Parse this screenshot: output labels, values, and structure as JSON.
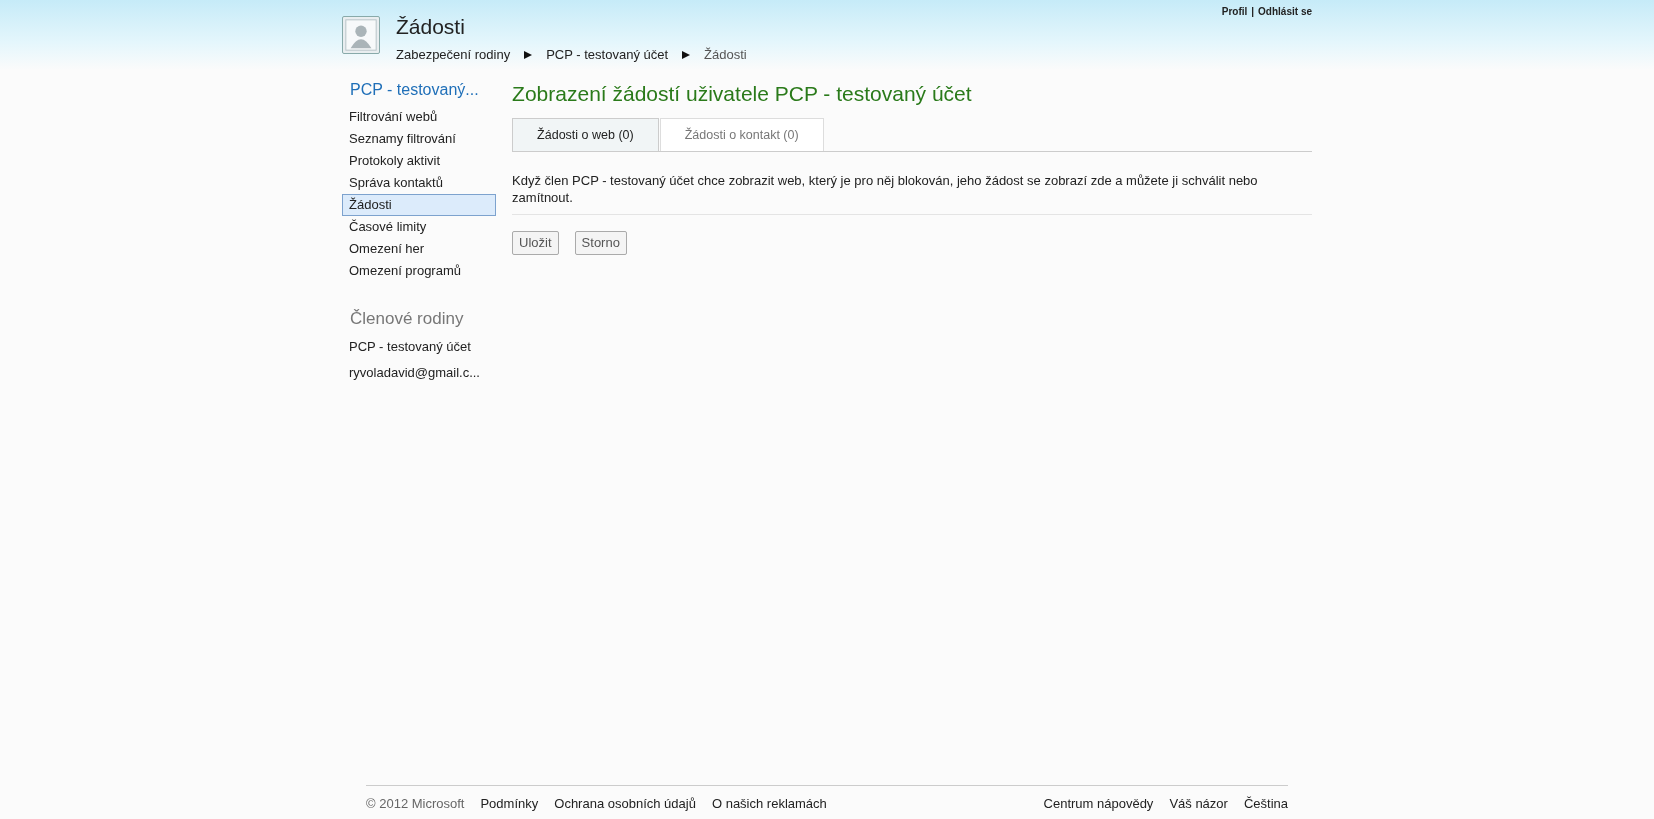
{
  "top_links": [
    "Profil",
    "Odhlásit se"
  ],
  "top_links_separator": "|",
  "header": {
    "title": "Žádosti",
    "breadcrumb": [
      "Zabezpečení rodiny",
      "PCP - testovaný účet",
      "Žádosti"
    ]
  },
  "sidebar": {
    "title": "PCP - testovaný...",
    "items": [
      {
        "label": "Filtrování webů",
        "selected": false
      },
      {
        "label": "Seznamy filtrování",
        "selected": false
      },
      {
        "label": "Protokoly aktivit",
        "selected": false
      },
      {
        "label": "Správa kontaktů",
        "selected": false
      },
      {
        "label": "Žádosti",
        "selected": true
      },
      {
        "label": "Časové limity",
        "selected": false
      },
      {
        "label": "Omezení her",
        "selected": false
      },
      {
        "label": "Omezení programů",
        "selected": false
      }
    ],
    "members_title": "Členové rodiny",
    "members": [
      "PCP - testovaný účet",
      "ryvoladavid@gmail.c..."
    ]
  },
  "main": {
    "heading": "Zobrazení žádostí uživatele PCP - testovaný účet",
    "tabs": [
      {
        "label": "Žádosti o web (0)",
        "selected": true
      },
      {
        "label": "Žádosti o kontakt (0)",
        "selected": false
      }
    ],
    "description": "Když člen PCP - testovaný účet chce zobrazit web, který je pro něj blokován, jeho žádost se zobrazí zde a můžete ji schválit nebo zamítnout.",
    "buttons": [
      "Uložit",
      "Storno"
    ]
  },
  "footer": {
    "copyright": "© 2012 Microsoft",
    "left_links": [
      "Podmínky",
      "Ochrana osobních údajů",
      "O našich reklamách"
    ],
    "right_links": [
      "Centrum nápovědy",
      "Váš názor",
      "Čeština"
    ]
  }
}
